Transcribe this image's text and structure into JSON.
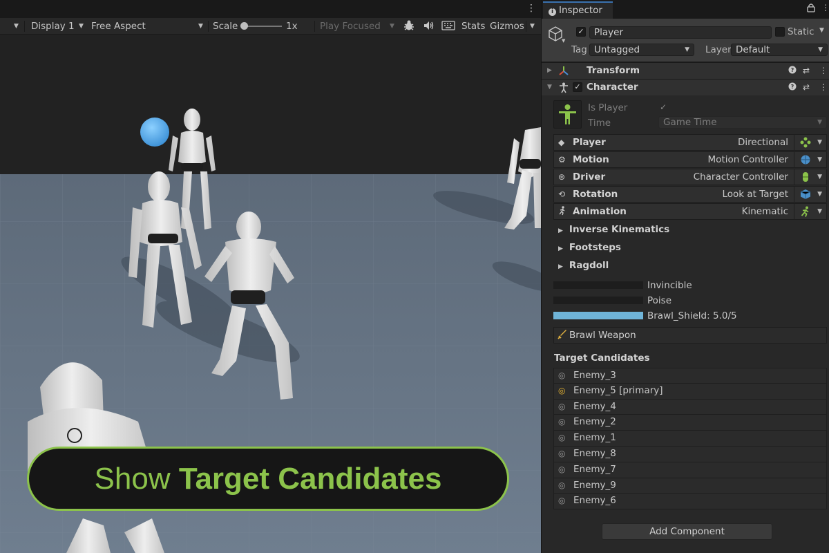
{
  "game_view": {
    "toolbar": {
      "display": "Display 1",
      "aspect": "Free Aspect",
      "scale_label": "Scale",
      "scale_value": "1x",
      "play_mode": "Play Focused",
      "stats": "Stats",
      "gizmos": "Gizmos"
    },
    "overlay": {
      "text_regular": "Show",
      "text_bold": "Target Candidates"
    }
  },
  "inspector": {
    "tab_title": "Inspector",
    "object": {
      "name": "Player",
      "static_label": "Static",
      "tag_label": "Tag",
      "tag_value": "Untagged",
      "layer_label": "Layer",
      "layer_value": "Default"
    },
    "components": {
      "transform": {
        "title": "Transform"
      },
      "character": {
        "title": "Character",
        "is_player_label": "Is Player",
        "time_label": "Time",
        "time_value": "Game Time",
        "rows": [
          {
            "name": "Player",
            "value": "Directional",
            "icon": "dpad-icon",
            "badge_color": "#8cc34b"
          },
          {
            "name": "Motion",
            "value": "Motion Controller",
            "icon": "gear-icon",
            "badge_color": "#5aa0d0"
          },
          {
            "name": "Driver",
            "value": "Character Controller",
            "icon": "wheel-icon",
            "badge_color": "#8cc34b"
          },
          {
            "name": "Rotation",
            "value": "Look at Target",
            "icon": "rotate-icon",
            "badge_color": "#5aa0d0"
          },
          {
            "name": "Animation",
            "value": "Kinematic",
            "icon": "running-icon",
            "badge_color": "#8cc34b"
          }
        ],
        "foldouts": [
          "Inverse Kinematics",
          "Footsteps",
          "Ragdoll"
        ]
      }
    },
    "stats": {
      "invincible": {
        "label": "Invincible",
        "fill": 0
      },
      "poise": {
        "label": "Poise",
        "fill": 0
      },
      "shield": {
        "label": "Brawl_Shield: 5.0/5",
        "fill": 1.0
      }
    },
    "weapon": "Brawl Weapon",
    "target_candidates": {
      "title": "Target Candidates",
      "items": [
        "Enemy_3",
        "Enemy_5 [primary]",
        "Enemy_4",
        "Enemy_2",
        "Enemy_1",
        "Enemy_8",
        "Enemy_7",
        "Enemy_9",
        "Enemy_6"
      ]
    },
    "add_component": "Add Component"
  }
}
